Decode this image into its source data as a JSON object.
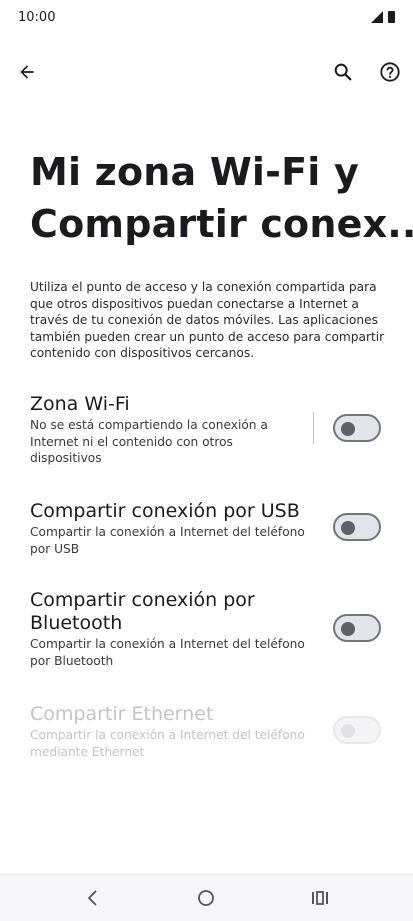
{
  "status_bar": {
    "time": "10:00"
  },
  "app_bar": {
    "back_icon": "arrow-left-icon",
    "search_icon": "search-icon",
    "help_icon": "help-circle-icon"
  },
  "page": {
    "title_line1": "Mi zona Wi-Fi y",
    "title_line2": "Compartir conex...",
    "description": "Utiliza el punto de acceso y la conexión compartida para que otros dispositivos puedan conectarse a Internet a través de tu conexión de datos móviles. Las aplicaciones también pueden crear un punto de acceso para compartir contenido con dispositivos cercanos."
  },
  "settings": [
    {
      "title": "Zona Wi-Fi",
      "subtitle": "No se está compartiendo la conexión a Internet ni el contenido con otros dispositivos",
      "enabled": true,
      "on": false
    },
    {
      "title": "Compartir conexión por USB",
      "subtitle": "Compartir la conexión a Internet del teléfono por USB",
      "enabled": true,
      "on": false
    },
    {
      "title": "Compartir conexión por Bluetooth",
      "subtitle": "Compartir la conexión a Internet del teléfono por Bluetooth",
      "enabled": true,
      "on": false
    },
    {
      "title": "Compartir Ethernet",
      "subtitle": "Compartir la conexión a Internet del teléfono mediante Ethernet",
      "enabled": false,
      "on": false
    }
  ],
  "colors": {
    "text": "#1b1b1f",
    "disabled_text": "#c4c4c8",
    "toggle_track": "#e3e3ea",
    "toggle_outline": "#74757c"
  },
  "nav_bar": {
    "back_icon": "nav-back-icon",
    "home_icon": "nav-home-icon",
    "recents_icon": "nav-recents-icon"
  }
}
